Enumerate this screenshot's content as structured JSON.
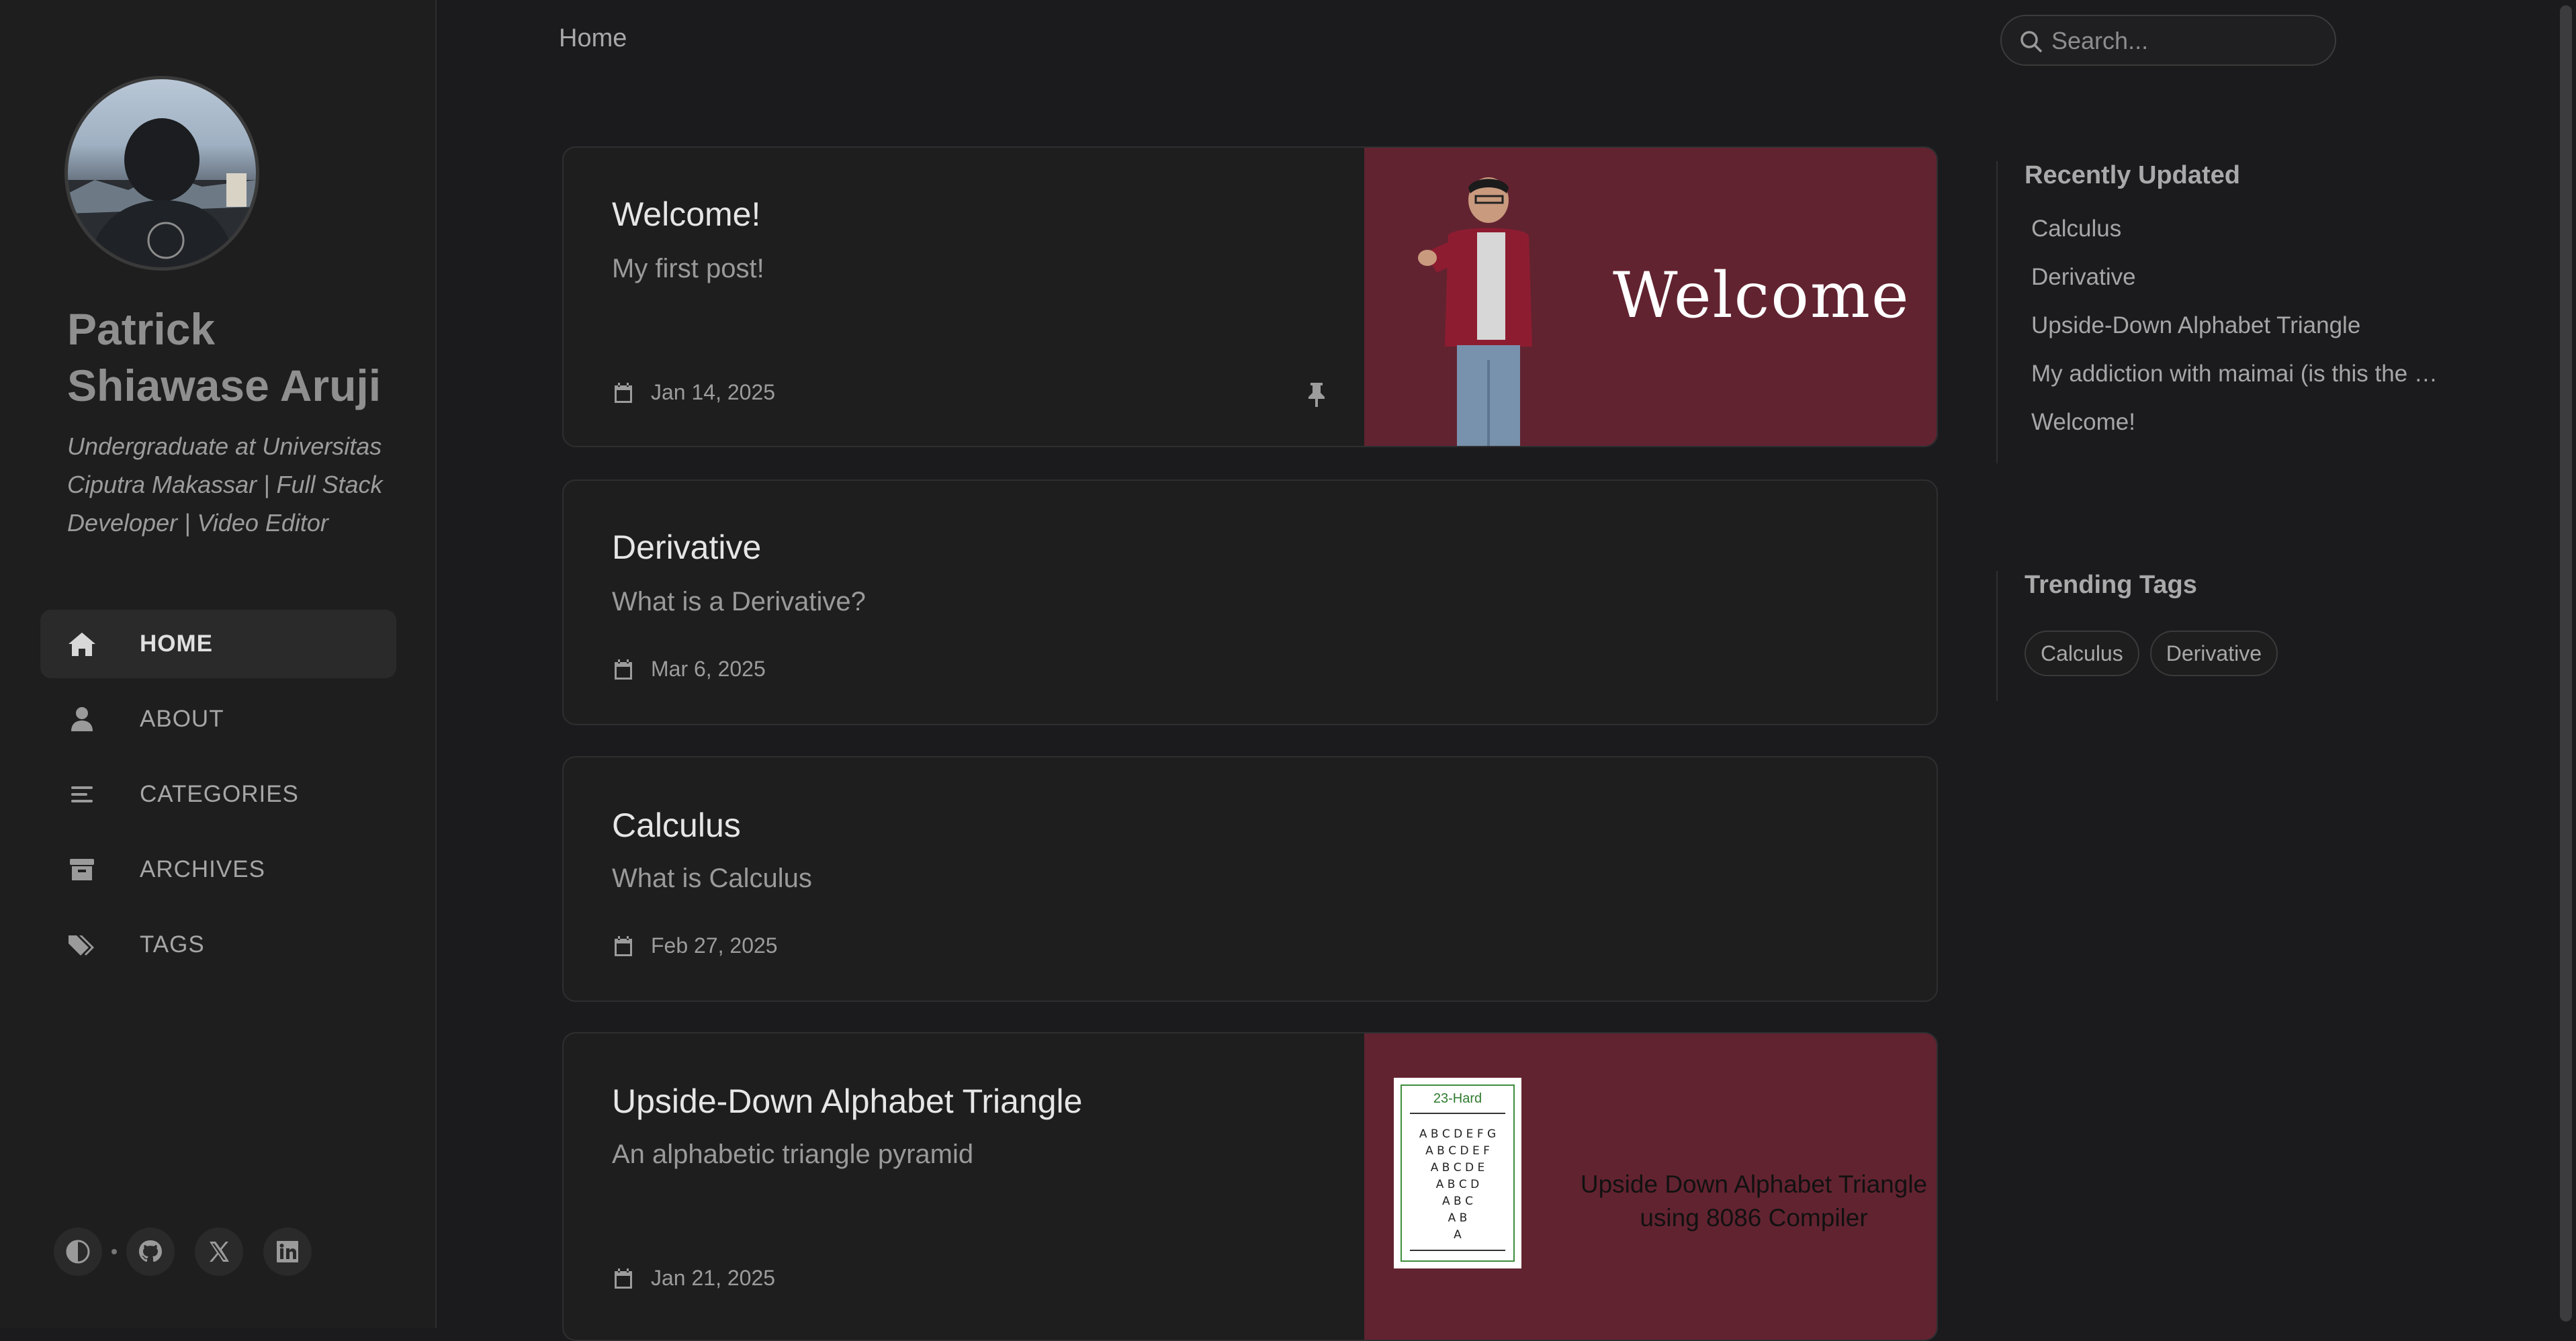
{
  "sidebar": {
    "name": "Patrick Shiawase Aruji",
    "tagline": "Undergraduate at Universitas Ciputra Makassar | Full Stack Developer | Video Editor",
    "nav": [
      {
        "label": "HOME",
        "icon": "home-icon",
        "active": true
      },
      {
        "label": "ABOUT",
        "icon": "user-icon",
        "active": false
      },
      {
        "label": "CATEGORIES",
        "icon": "list-icon",
        "active": false
      },
      {
        "label": "ARCHIVES",
        "icon": "archive-icon",
        "active": false
      },
      {
        "label": "TAGS",
        "icon": "tags-icon",
        "active": false
      }
    ],
    "social": [
      "theme-toggle-icon",
      "github-icon",
      "x-twitter-icon",
      "linkedin-icon"
    ]
  },
  "topbar": {
    "breadcrumb": "Home",
    "search_placeholder": "Search..."
  },
  "posts": [
    {
      "title": "Welcome!",
      "description": "My first post!",
      "date": "Jan 14, 2025",
      "pinned": true,
      "image_text": "Welcome"
    },
    {
      "title": "Derivative",
      "description": "What is a Derivative?",
      "date": "Mar 6, 2025",
      "pinned": false
    },
    {
      "title": "Calculus",
      "description": "What is Calculus",
      "date": "Feb 27, 2025",
      "pinned": false
    },
    {
      "title": "Upside-Down Alphabet Triangle",
      "description": "An alphabetic triangle pyramid",
      "date": "Jan 21, 2025",
      "pinned": false,
      "image_title": "23-Hard",
      "image_lines": [
        "A B C D E F G",
        "A B C D E F",
        "A B C D E",
        "A B C D",
        "A B C",
        "A B",
        "A"
      ],
      "image_caption_1": "Upside Down Alphabet Triangle",
      "image_caption_2": "using 8086 Compiler"
    }
  ],
  "panel": {
    "recently_updated_heading": "Recently Updated",
    "recently_updated": [
      "Calculus",
      "Derivative",
      "Upside-Down Alphabet Triangle",
      "My addiction with maimai (is this the w…",
      "Welcome!"
    ],
    "trending_tags_heading": "Trending Tags",
    "trending_tags": [
      "Calculus",
      "Derivative"
    ]
  },
  "colors": {
    "background": "#1b1b1e",
    "card": "#1e1e1f",
    "image_banner": "#622330"
  }
}
